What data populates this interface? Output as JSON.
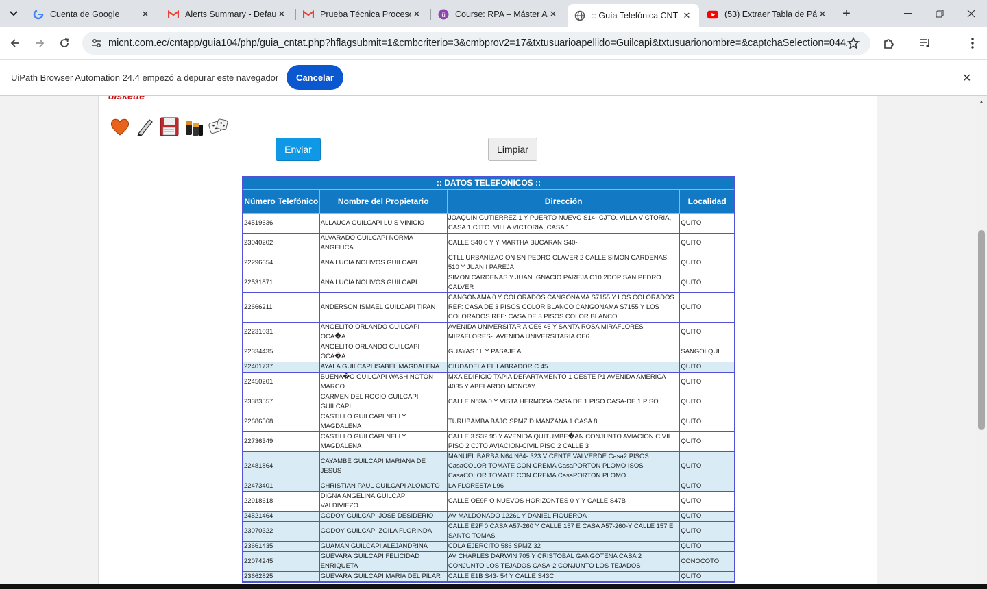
{
  "tabs": [
    {
      "title": "Cuenta de Google",
      "icon": "google-icon"
    },
    {
      "title": "Alerts Summary - Defau",
      "icon": "gmail-icon"
    },
    {
      "title": "Prueba Técnica Proceso",
      "icon": "gmail-icon"
    },
    {
      "title": "Course: RPA – Máster Au",
      "icon": "course-icon"
    },
    {
      "title": ":: Guía Telefónica CNT E",
      "icon": "globe-icon"
    },
    {
      "title": "(53) Extraer Tabla de Pá",
      "icon": "youtube-icon"
    }
  ],
  "toolbar": {
    "url": "micnt.com.ec/cntapp/guia104/php/guia_cntat.php?hflagsubmit=1&cmbcriterio=3&cmbprov2=17&txtusuarioapellido=Guilcapi&txtusuarionombre=&captchaSelection=044..."
  },
  "infobar": {
    "message": "UiPath Browser Automation 24.4 empezó a depurar este navegador",
    "cancel_label": "Cancelar"
  },
  "form": {
    "captcha_label": "diskette",
    "captcha_icons": [
      "heart-icon",
      "pencil-icon",
      "diskette-icon",
      "batteries-icon",
      "dice-icon"
    ],
    "submit_label": "Enviar",
    "clear_label": "Limpiar"
  },
  "table": {
    "caption": ":: DATOS TELEFONICOS ::",
    "headers": [
      "Número Telefónico",
      "Nombre del Propietario",
      "Dirección",
      "Localidad"
    ],
    "rows": [
      [
        "24519636",
        "ALLAUCA GUILCAPI LUIS VINICIO",
        "JOAQUIN GUTIERREZ 1 Y PUERTO NUEVO S14- CJTO. VILLA VICTORIA, CASA 1 CJTO. VILLA VICTORIA, CASA 1",
        "QUITO"
      ],
      [
        "23040202",
        "ALVARADO GUILCAPI NORMA ANGELICA",
        "CALLE S40 0 Y Y MARTHA BUCARAN S40-",
        "QUITO"
      ],
      [
        "22296654",
        "ANA LUCIA NOLIVOS GUILCAPI",
        "CTLL URBANIZACION SN PEDRO CLAVER 2 CALLE SIMON CARDENAS 510 Y JUAN I PAREJA",
        "QUITO"
      ],
      [
        "22531871",
        "ANA LUCIA NOLIVOS GUILCAPI",
        "SIMON CARDENAS Y JUAN IGNACIO PAREJA C10 2DOP SAN PEDRO CALVER",
        "QUITO"
      ],
      [
        "22666211",
        "ANDERSON ISMAEL GUILCAPI TIPAN",
        "CANGONAMA 0 Y COLORADOS CANGONAMA S7155 Y LOS COLORADOS REF: CASA DE 3 PISOS COLOR BLANCO CANGONAMA S7155 Y LOS COLORADOS REF: CASA DE 3 PISOS COLOR BLANCO",
        "QUITO"
      ],
      [
        "22231031",
        "ANGELITO ORLANDO GUILCAPI OCA�A",
        "AVENIDA UNIVERSITARIA OE6 46 Y SANTA ROSA MIRAFLORES MIRAFLORES-. AVENIDA UNIVERSITARIA OE6",
        "QUITO"
      ],
      [
        "22334435",
        "ANGELITO ORLANDO GUILCAPI OCA�A",
        "GUAYAS 1L Y PASAJE A",
        "SANGOLQUI"
      ],
      [
        "22401737",
        "AYALA GUILCAPI ISABEL MAGDALENA",
        "CIUDADELA EL LABRADOR C 45",
        "QUITO"
      ],
      [
        "22450201",
        "BUENA�O GUILCAPI WASHINGTON MARCO",
        "MXA EDIFICIO TAPIA DEPARTAMENTO 1 OESTE P1 AVENIDA AMERICA 4035 Y ABELARDO MONCAY",
        "QUITO"
      ],
      [
        "23383557",
        "CARMEN DEL ROCIO GUILCAPI GUILCAPI",
        "CALLE N83A 0 Y VISTA HERMOSA CASA DE 1 PISO CASA-DE 1 PISO",
        "QUITO"
      ],
      [
        "22686568",
        "CASTILLO GUILCAPI NELLY MAGDALENA",
        "TURUBAMBA BAJO SPMZ D MANZANA 1 CASA 8",
        "QUITO"
      ],
      [
        "22736349",
        "CASTILLO GUILCAPI NELLY MAGDALENA",
        "CALLE 3 S32 95 Y AVENIDA QUITUMBE�AN CONJUNTO AVIACION CIVIL PISO 2 CJTO AVIACION-CIVIL PISO 2 CALLE 3",
        "QUITO"
      ],
      [
        "22481864",
        "CAYAMBE GUILCAPI MARIANA DE JESUS",
        "MANUEL BARBA N64 N64- 323 VICENTE VALVERDE Casa2 PISOS CasaCOLOR TOMATE CON CREMA CasaPORTON PLOMO ISOS CasaCOLOR TOMATE CON CREMA CasaPORTON PLOMO",
        "QUITO"
      ],
      [
        "22473401",
        "CHRISTIAN PAUL GUILCAPI ALOMOTO",
        "LA FLORESTA L96",
        "QUITO"
      ],
      [
        "22918618",
        "DIGNA ANGELINA GUILCAPI VALDIVIEZO",
        "CALLE OE9F O NUEVOS HORIZONTES 0 Y Y CALLE S47B",
        "QUITO"
      ],
      [
        "24521464",
        "GODOY GUILCAPI JOSE DESIDERIO",
        "AV MALDONADO 1226L Y DANIEL FIGUEROA",
        "QUITO"
      ],
      [
        "23070322",
        "GODOY GUILCAPI ZOILA FLORINDA",
        "CALLE E2F 0 CASA A57-260 Y CALLE 157 E CASA A57-260-Y CALLE 157 E SANTO TOMAS I",
        "QUITO"
      ],
      [
        "23661435",
        "GUAMAN GUILCAPI ALEJANDRINA",
        "CDLA EJERCITO 586 SPMZ 32",
        "QUITO"
      ],
      [
        "22074245",
        "GUEVARA GUILCAPI FELICIDAD ENRIQUETA",
        "AV CHARLES DARWIN 705 Y CRISTOBAL GANGOTENA CASA 2 CONJUNTO LOS TEJADOS CASA-2 CONJUNTO LOS TEJADOS",
        "CONOCOTO"
      ],
      [
        "23662825",
        "GUEVARA GUILCAPI MARIA DEL PILAR",
        "CALLE E1B S43- 54 Y CALLE S43C",
        "QUITO"
      ]
    ],
    "alt_rows": [
      7,
      12,
      13,
      15,
      16,
      17,
      18,
      19
    ]
  }
}
